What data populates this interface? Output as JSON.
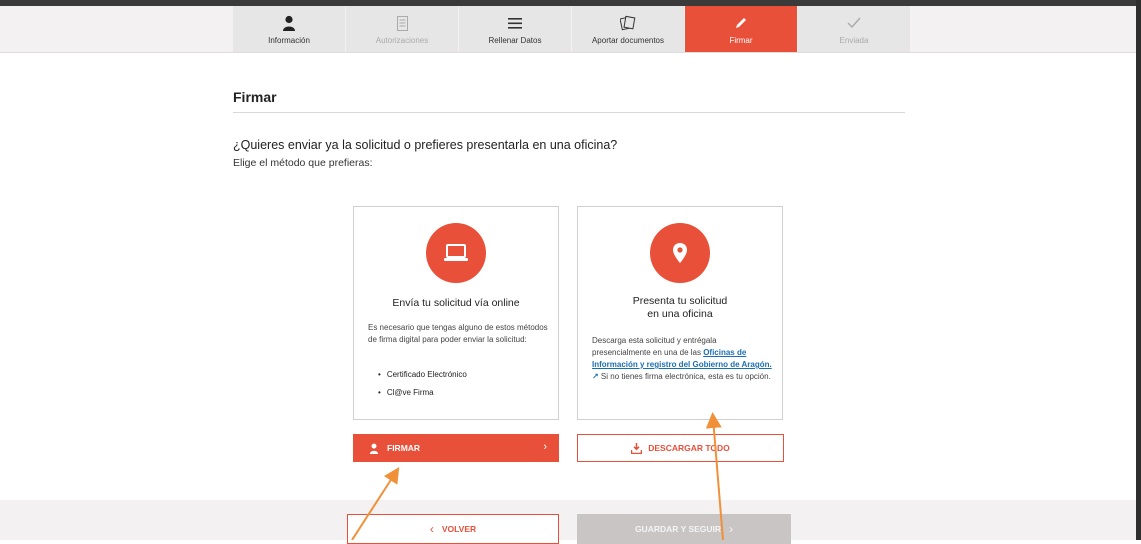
{
  "steps": [
    {
      "label": "Información",
      "icon": "user-icon",
      "state": "done"
    },
    {
      "label": "Autorizaciones",
      "icon": "document-icon",
      "state": "disabled"
    },
    {
      "label": "Rellenar Datos",
      "icon": "list-icon",
      "state": "done"
    },
    {
      "label": "Aportar documentos",
      "icon": "documents-icon",
      "state": "done"
    },
    {
      "label": "Firmar",
      "icon": "pencil-icon",
      "state": "active"
    },
    {
      "label": "Enviada",
      "icon": "check-icon",
      "state": "disabled"
    }
  ],
  "main": {
    "title": "Firmar",
    "question": "¿Quieres enviar ya la solicitud o prefieres presentarla en una oficina?",
    "subtitle": "Elige el método que prefieras:"
  },
  "online_card": {
    "icon": "laptop-icon",
    "title": "Envía tu solicitud vía online",
    "text": "Es necesario que tengas alguno de estos métodos de firma digital para poder enviar la solicitud:",
    "bullets": [
      "Certificado Electrónico",
      "Cl@ve Firma"
    ],
    "button_label": "FIRMAR"
  },
  "office_card": {
    "icon": "location-pin-icon",
    "title_line1": "Presenta tu solicitud",
    "title_line2": "en una oficina",
    "text_before": "Descarga esta solicitud y entrégala presencialmente en una de las ",
    "link_label": "Oficinas de Información y registro del Gobierno de Aragón.",
    "text_after": " Si no tienes firma electrónica, esta es tu opción.",
    "button_label": "DESCARGAR TODO"
  },
  "footer": {
    "back_label": "VOLVER",
    "next_label": "GUARDAR Y SEGUIR"
  },
  "colors": {
    "accent": "#e8503a",
    "link": "#1a6fb3",
    "arrow": "#f0913a",
    "disabled": "#c9c5c5"
  }
}
